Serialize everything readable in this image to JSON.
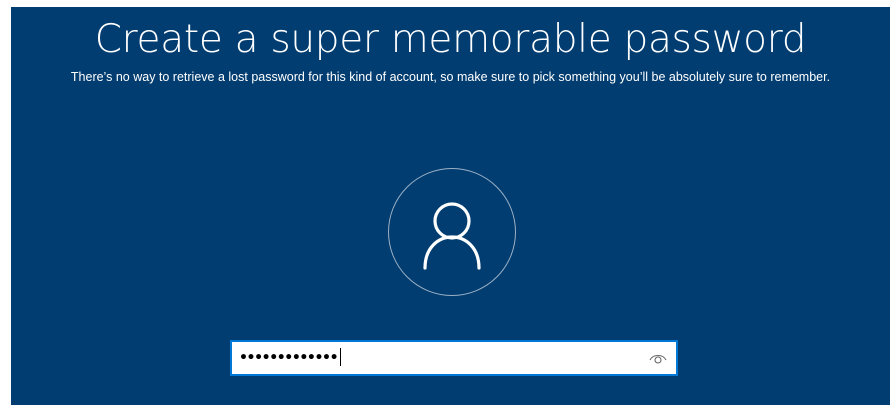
{
  "setup": {
    "title": "Create a super memorable password",
    "subtitle": "There’s no way to retrieve a lost password for this kind of account, so make sure to pick something you’ll be absolutely sure to remember.",
    "avatar_icon": "user-icon",
    "password_field": {
      "masked_value": "•••••••••••••",
      "reveal_icon": "eye-icon"
    }
  },
  "colors": {
    "background": "#013d70",
    "field_border": "#0078d7",
    "text": "#ffffff"
  }
}
